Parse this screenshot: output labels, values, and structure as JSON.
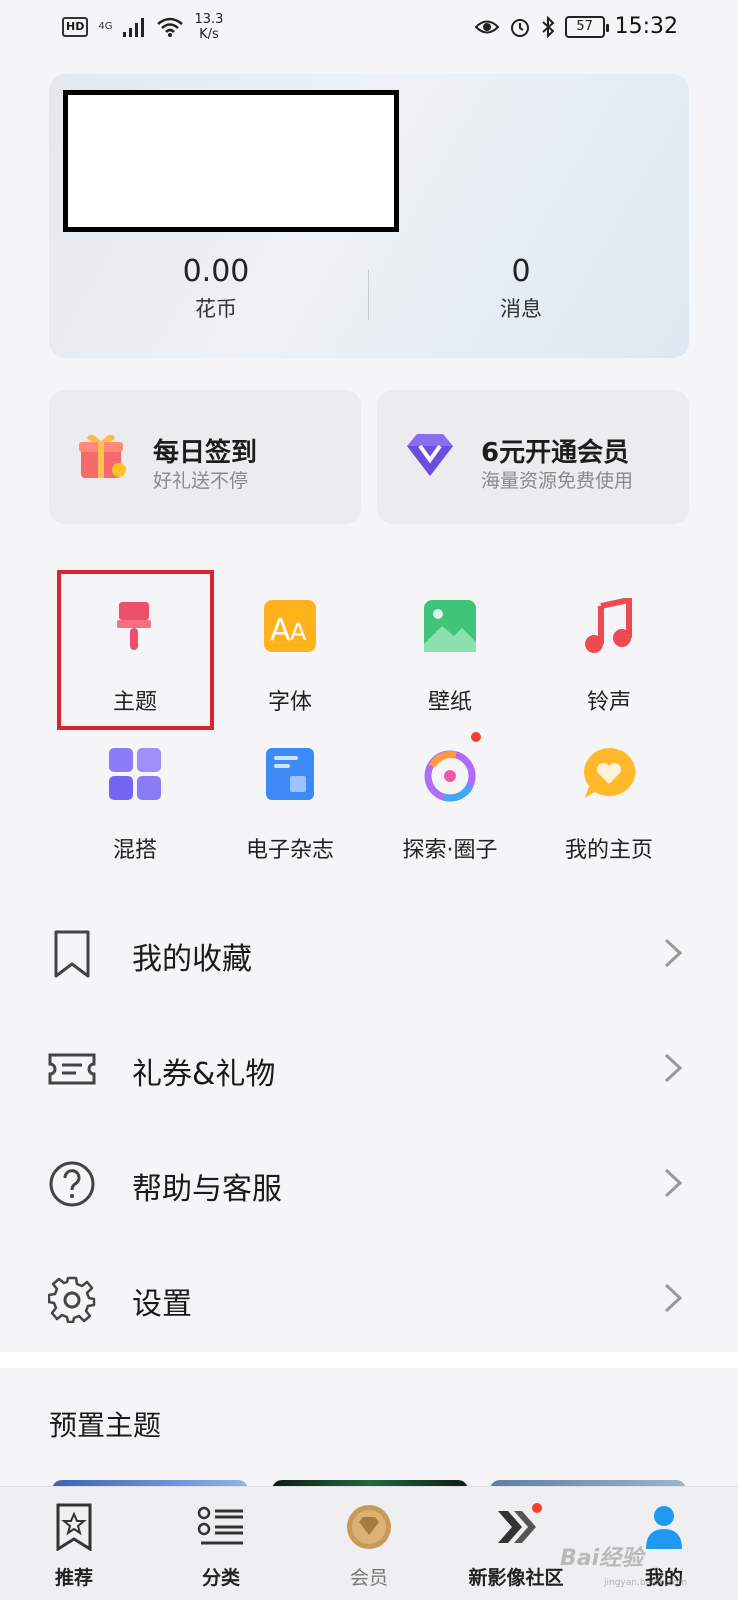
{
  "status_bar": {
    "hd": "HD",
    "network": "4G",
    "speed_value": "13.3",
    "speed_unit": "K/s",
    "battery": "57",
    "time": "15:32"
  },
  "header": {
    "coins_value": "0.00",
    "coins_label": "花币",
    "messages_value": "0",
    "messages_label": "消息"
  },
  "promos": [
    {
      "title": "每日签到",
      "subtitle": "好礼送不停",
      "icon": "gift-icon"
    },
    {
      "title": "6元开通会员",
      "subtitle": "海量资源免费使用",
      "icon": "vip-diamond-icon"
    }
  ],
  "grid": [
    {
      "label": "主题",
      "icon": "paintbrush-icon"
    },
    {
      "label": "字体",
      "icon": "font-icon"
    },
    {
      "label": "壁纸",
      "icon": "wallpaper-icon"
    },
    {
      "label": "铃声",
      "icon": "music-note-icon"
    },
    {
      "label": "混搭",
      "icon": "mix-grid-icon"
    },
    {
      "label": "电子杂志",
      "icon": "magazine-icon"
    },
    {
      "label": "探索·圈子",
      "icon": "explore-circle-icon"
    },
    {
      "label": "我的主页",
      "icon": "heart-bubble-icon"
    }
  ],
  "menu": [
    {
      "label": "我的收藏",
      "icon": "bookmark-icon"
    },
    {
      "label": "礼券&礼物",
      "icon": "coupon-icon"
    },
    {
      "label": "帮助与客服",
      "icon": "help-icon"
    },
    {
      "label": "设置",
      "icon": "gear-icon"
    }
  ],
  "preset": {
    "title": "预置主题"
  },
  "bottom_nav": [
    {
      "label": "推荐",
      "icon": "star-bookmark-icon"
    },
    {
      "label": "分类",
      "icon": "list-icon"
    },
    {
      "label": "会员",
      "icon": "member-coin-icon"
    },
    {
      "label": "新影像社区",
      "icon": "community-icon"
    },
    {
      "label": "我的",
      "icon": "person-icon"
    }
  ],
  "watermark": {
    "text": "Bai经验",
    "sub": "jingyan.baidu.com"
  },
  "colors": {
    "highlight": "#d9262e",
    "brush": "#ee4f6b",
    "badge": "#f3402f"
  }
}
